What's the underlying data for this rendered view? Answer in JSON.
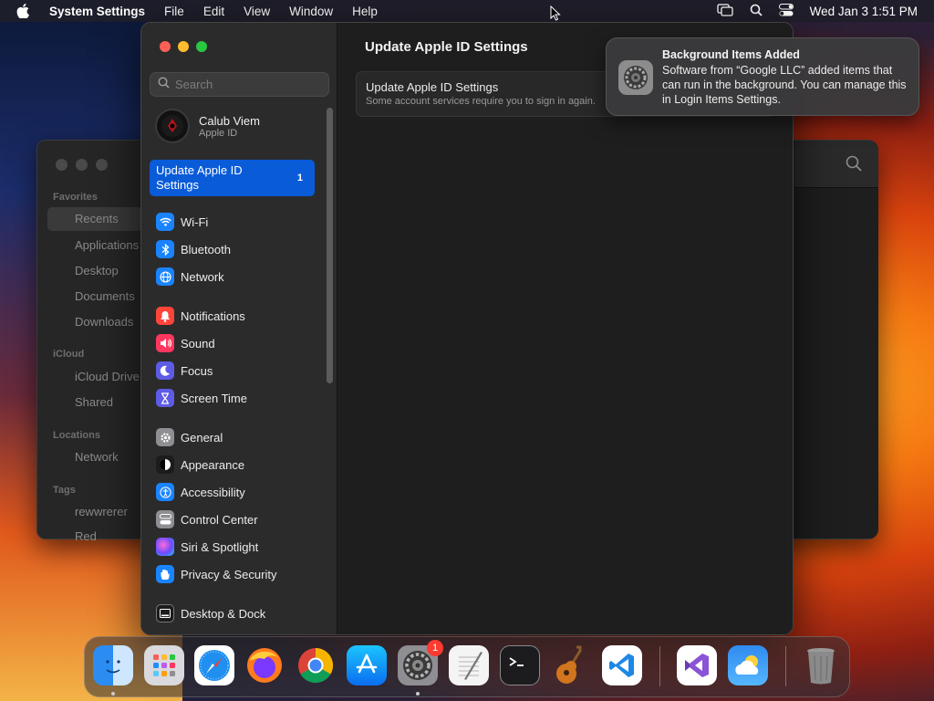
{
  "menubar": {
    "app_name": "System Settings",
    "items": [
      "File",
      "Edit",
      "View",
      "Window",
      "Help"
    ],
    "clock": "Wed Jan 3  1:51 PM"
  },
  "finder": {
    "sections": {
      "favorites": "Favorites",
      "icloud": "iCloud",
      "locations": "Locations",
      "tags": "Tags"
    },
    "favorites": [
      "Recents",
      "Applications",
      "Desktop",
      "Documents",
      "Downloads"
    ],
    "icloud": [
      "iCloud Drive",
      "Shared"
    ],
    "locations": [
      "Network"
    ],
    "tags": [
      "rewwrerer",
      "Red"
    ]
  },
  "settings": {
    "search_placeholder": "Search",
    "account": {
      "name": "Calub Viem",
      "sub": "Apple ID"
    },
    "update_item": {
      "label": "Update Apple ID Settings",
      "count": "1"
    },
    "nav": [
      {
        "label": "Wi-Fi",
        "icon": "wifi-icon",
        "color": "#1a84ff"
      },
      {
        "label": "Bluetooth",
        "icon": "bluetooth-icon",
        "color": "#1a84ff"
      },
      {
        "label": "Network",
        "icon": "globe-icon",
        "color": "#1a84ff"
      },
      {
        "label": "Notifications",
        "icon": "bell-icon",
        "color": "#ff453a"
      },
      {
        "label": "Sound",
        "icon": "speaker-icon",
        "color": "#ff375f"
      },
      {
        "label": "Focus",
        "icon": "moon-icon",
        "color": "#5e5ce6"
      },
      {
        "label": "Screen Time",
        "icon": "hourglass-icon",
        "color": "#5e5ce6"
      },
      {
        "label": "General",
        "icon": "gear-icon",
        "color": "#8e8e93"
      },
      {
        "label": "Appearance",
        "icon": "appearance-icon",
        "color": "#1c1c1e"
      },
      {
        "label": "Accessibility",
        "icon": "accessibility-icon",
        "color": "#1a84ff"
      },
      {
        "label": "Control Center",
        "icon": "control-center-icon",
        "color": "#8e8e93"
      },
      {
        "label": "Siri & Spotlight",
        "icon": "siri-icon",
        "color": "#bf5af2"
      },
      {
        "label": "Privacy & Security",
        "icon": "hand-icon",
        "color": "#1a84ff"
      },
      {
        "label": "Desktop & Dock",
        "icon": "dock-icon",
        "color": "#1c1c1e"
      }
    ],
    "main": {
      "title": "Update Apple ID Settings",
      "card_title": "Update Apple ID Settings",
      "card_sub": "Some account services require you to sign in again."
    }
  },
  "notification": {
    "title": "Background Items Added",
    "body": "Software from “Google LLC” added items that can run in the background. You can manage this in Login Items Settings."
  },
  "dock": {
    "apps": [
      "Finder",
      "Launchpad",
      "Safari",
      "Firefox",
      "Google Chrome",
      "App Store",
      "System Settings",
      "TextEdit",
      "Terminal",
      "GarageBand",
      "Visual Studio Code",
      "Visual Studio",
      "Weather",
      "Trash"
    ],
    "settings_badge": "1"
  }
}
